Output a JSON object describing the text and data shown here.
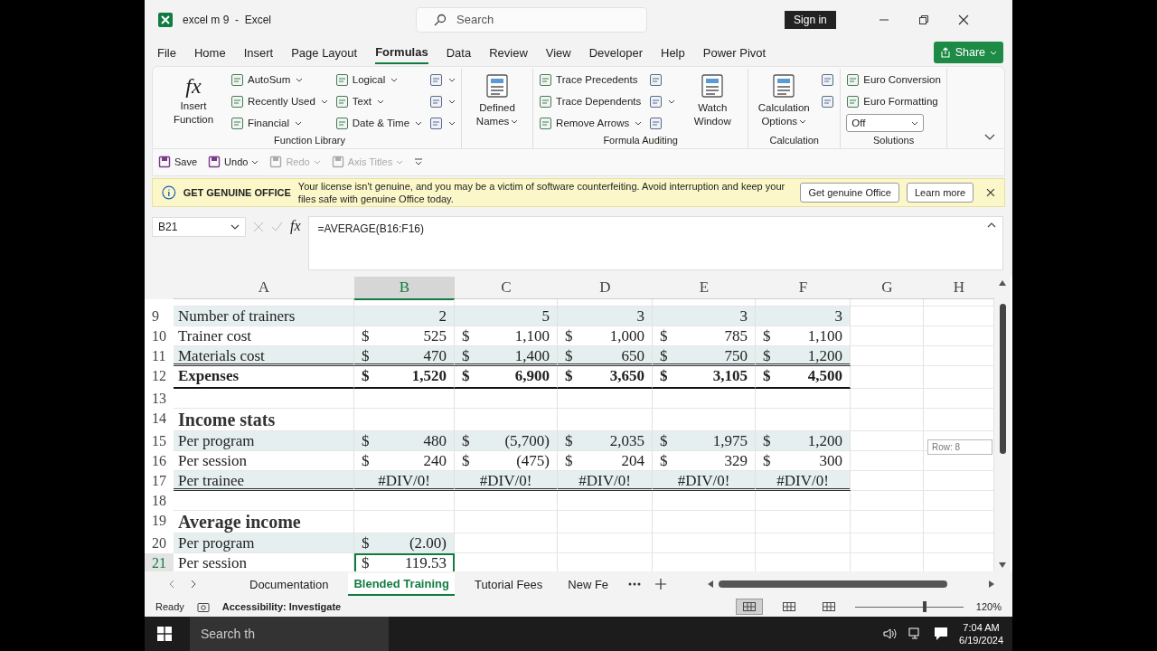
{
  "window": {
    "title": "excel m 9  -  Excel",
    "search_placeholder": "Search",
    "sign_in": "Sign in"
  },
  "menu_tabs": [
    {
      "label": "File",
      "selected": false
    },
    {
      "label": "Home",
      "selected": false
    },
    {
      "label": "Insert",
      "selected": false
    },
    {
      "label": "Page Layout",
      "selected": false
    },
    {
      "label": "Formulas",
      "selected": true
    },
    {
      "label": "Data",
      "selected": false
    },
    {
      "label": "Review",
      "selected": false
    },
    {
      "label": "View",
      "selected": false
    },
    {
      "label": "Developer",
      "selected": false
    },
    {
      "label": "Help",
      "selected": false
    },
    {
      "label": "Power Pivot",
      "selected": false
    }
  ],
  "share_button": "Share",
  "ribbon": {
    "groups": [
      {
        "label": "Function Library",
        "columns": [
          [
            {
              "kind": "big",
              "label": "Insert Function",
              "glyph": "fx",
              "caret": false
            }
          ],
          [
            {
              "kind": "small",
              "label": "AutoSum",
              "caret": true
            },
            {
              "kind": "small",
              "label": "Recently Used",
              "caret": true
            },
            {
              "kind": "small",
              "label": "Financial",
              "caret": true
            }
          ],
          [
            {
              "kind": "small",
              "label": "Logical",
              "caret": true
            },
            {
              "kind": "small",
              "label": "Text",
              "caret": true
            },
            {
              "kind": "small",
              "label": "Date & Time",
              "caret": true
            }
          ],
          [
            {
              "kind": "icon",
              "caret": true
            },
            {
              "kind": "icon",
              "caret": true
            },
            {
              "kind": "icon",
              "caret": true
            }
          ]
        ]
      },
      {
        "columns": [
          [
            {
              "kind": "big",
              "label": "Defined Names",
              "caret": true
            }
          ]
        ]
      },
      {
        "label": "Formula Auditing",
        "columns": [
          [
            {
              "kind": "small",
              "label": "Trace Precedents",
              "caret": false
            },
            {
              "kind": "small",
              "label": "Trace Dependents",
              "caret": false
            },
            {
              "kind": "small",
              "label": "Remove Arrows",
              "caret": true
            }
          ],
          [
            {
              "kind": "icon",
              "caret": false
            },
            {
              "kind": "icon",
              "caret": true
            },
            {
              "kind": "icon",
              "caret": false
            }
          ],
          [
            {
              "kind": "big",
              "label": "Watch Window",
              "caret": false
            }
          ]
        ]
      },
      {
        "label": "Calculation",
        "columns": [
          [
            {
              "kind": "big",
              "label": "Calculation Options",
              "caret": true
            }
          ],
          [
            {
              "kind": "icon",
              "caret": false
            },
            {
              "kind": "icon",
              "caret": false
            }
          ]
        ]
      },
      {
        "label": "Solutions",
        "columns": [
          [
            {
              "kind": "small",
              "label": "Euro Conversion",
              "caret": false
            },
            {
              "kind": "small",
              "label": "Euro Formatting",
              "caret": false
            },
            {
              "kind": "select",
              "label": "Off",
              "caret": true
            }
          ]
        ]
      }
    ]
  },
  "quick_access": [
    {
      "label": "Save",
      "disabled": false,
      "caret": false
    },
    {
      "label": "Undo",
      "disabled": false,
      "caret": true
    },
    {
      "label": "Redo",
      "disabled": true,
      "caret": true
    },
    {
      "label": "Axis Titles",
      "disabled": true,
      "caret": true
    }
  ],
  "info_bar": {
    "title": "GET GENUINE OFFICE",
    "message": "Your license isn't genuine, and you may be a victim of software counterfeiting. Avoid interruption and keep your files safe with genuine Office today.",
    "buttons": [
      "Get genuine Office",
      "Learn more"
    ]
  },
  "formula_bar": {
    "name_box": "B21",
    "fx": "fx",
    "formula": "=AVERAGE(B16:F16)"
  },
  "columns": [
    {
      "label": "A",
      "selected": false
    },
    {
      "label": "B",
      "selected": true
    },
    {
      "label": "C",
      "selected": false
    },
    {
      "label": "D",
      "selected": false
    },
    {
      "label": "E",
      "selected": false
    },
    {
      "label": "F",
      "selected": false
    },
    {
      "label": "G",
      "selected": false
    },
    {
      "label": "H",
      "selected": false
    }
  ],
  "rows": [
    {
      "num": "9",
      "kind": "data",
      "selected": false,
      "shaded": true,
      "bold": false,
      "double_rule": false,
      "label": "Number of trainers",
      "cells": [
        {
          "kind": "number",
          "value": "2"
        },
        {
          "kind": "number",
          "value": "5"
        },
        {
          "kind": "number",
          "value": "3"
        },
        {
          "kind": "number",
          "value": "3"
        },
        {
          "kind": "number",
          "value": "3"
        }
      ]
    },
    {
      "num": "10",
      "kind": "data",
      "selected": false,
      "shaded": false,
      "bold": false,
      "double_rule": false,
      "label": "Trainer cost",
      "cells": [
        {
          "kind": "currency",
          "symbol": "$",
          "value": "525"
        },
        {
          "kind": "currency",
          "symbol": "$",
          "value": "1,100"
        },
        {
          "kind": "currency",
          "symbol": "$",
          "value": "1,000"
        },
        {
          "kind": "currency",
          "symbol": "$",
          "value": "785"
        },
        {
          "kind": "currency",
          "symbol": "$",
          "value": "1,100"
        }
      ]
    },
    {
      "num": "11",
      "kind": "data",
      "selected": false,
      "shaded": true,
      "bold": false,
      "double_rule": true,
      "label": "Materials cost",
      "cells": [
        {
          "kind": "currency",
          "symbol": "$",
          "value": "470"
        },
        {
          "kind": "currency",
          "symbol": "$",
          "value": "1,400"
        },
        {
          "kind": "currency",
          "symbol": "$",
          "value": "650"
        },
        {
          "kind": "currency",
          "symbol": "$",
          "value": "750"
        },
        {
          "kind": "currency",
          "symbol": "$",
          "value": "1,200"
        }
      ]
    },
    {
      "num": "12",
      "kind": "data",
      "selected": false,
      "shaded": false,
      "bold": true,
      "double_rule": false,
      "label": "Expenses",
      "cells": [
        {
          "kind": "currency",
          "symbol": "$",
          "value": "1,520"
        },
        {
          "kind": "currency",
          "symbol": "$",
          "value": "6,900"
        },
        {
          "kind": "currency",
          "symbol": "$",
          "value": "3,650"
        },
        {
          "kind": "currency",
          "symbol": "$",
          "value": "3,105"
        },
        {
          "kind": "currency",
          "symbol": "$",
          "value": "4,500"
        }
      ]
    },
    {
      "num": "13",
      "kind": "blank",
      "selected": false
    },
    {
      "num": "14",
      "kind": "heading",
      "selected": false,
      "label": "Income stats"
    },
    {
      "num": "15",
      "kind": "data",
      "selected": false,
      "shaded": true,
      "bold": false,
      "double_rule": false,
      "label": "Per program",
      "cells": [
        {
          "kind": "currency",
          "symbol": "$",
          "value": "480"
        },
        {
          "kind": "currency",
          "symbol": "$",
          "value": "(5,700)"
        },
        {
          "kind": "currency",
          "symbol": "$",
          "value": "2,035"
        },
        {
          "kind": "currency",
          "symbol": "$",
          "value": "1,975"
        },
        {
          "kind": "currency",
          "symbol": "$",
          "value": "1,200"
        }
      ]
    },
    {
      "num": "16",
      "kind": "data",
      "selected": false,
      "shaded": false,
      "bold": false,
      "double_rule": false,
      "label": "Per session",
      "cells": [
        {
          "kind": "currency",
          "symbol": "$",
          "value": "240"
        },
        {
          "kind": "currency",
          "symbol": "$",
          "value": "(475)"
        },
        {
          "kind": "currency",
          "symbol": "$",
          "value": "204"
        },
        {
          "kind": "currency",
          "symbol": "$",
          "value": "329"
        },
        {
          "kind": "currency",
          "symbol": "$",
          "value": "300"
        }
      ]
    },
    {
      "num": "17",
      "kind": "data",
      "selected": false,
      "shaded": true,
      "bold": false,
      "double_rule": true,
      "label": "Per trainee",
      "cells": [
        {
          "kind": "error",
          "value": "#DIV/0!"
        },
        {
          "kind": "error",
          "value": "#DIV/0!"
        },
        {
          "kind": "error",
          "value": "#DIV/0!"
        },
        {
          "kind": "error",
          "value": "#DIV/0!"
        },
        {
          "kind": "error",
          "value": "#DIV/0!"
        }
      ]
    },
    {
      "num": "18",
      "kind": "blank",
      "selected": false
    },
    {
      "num": "19",
      "kind": "heading",
      "selected": false,
      "label": "Average income"
    },
    {
      "num": "20",
      "kind": "data",
      "selected": false,
      "shaded": true,
      "bold": false,
      "double_rule": false,
      "label": "Per program",
      "cells": [
        {
          "kind": "currency",
          "symbol": "$",
          "value": "(2.00)"
        }
      ]
    },
    {
      "num": "21",
      "kind": "data",
      "selected": true,
      "shaded": false,
      "bold": false,
      "double_rule": false,
      "label": "Per session",
      "cells": [
        {
          "kind": "currency",
          "symbol": "$",
          "value": "119.53"
        }
      ]
    }
  ],
  "row_tooltip": "Row: 8",
  "sheet_tabs": [
    {
      "label": "Documentation",
      "selected": false
    },
    {
      "label": "Blended Training",
      "selected": true
    },
    {
      "label": "Tutorial Fees",
      "selected": false
    },
    {
      "label": "New Fe",
      "selected": false
    }
  ],
  "status_bar": {
    "mode": "Ready",
    "accessibility": "Accessibility: Investigate",
    "views": [
      {
        "selected": true
      },
      {
        "selected": false
      },
      {
        "selected": false
      }
    ],
    "zoom": {
      "level": 0.64,
      "reading": "120%"
    }
  },
  "taskbar": {
    "search_placeholder": "Search th",
    "time": "7:04 AM",
    "date": "6/19/2024"
  }
}
